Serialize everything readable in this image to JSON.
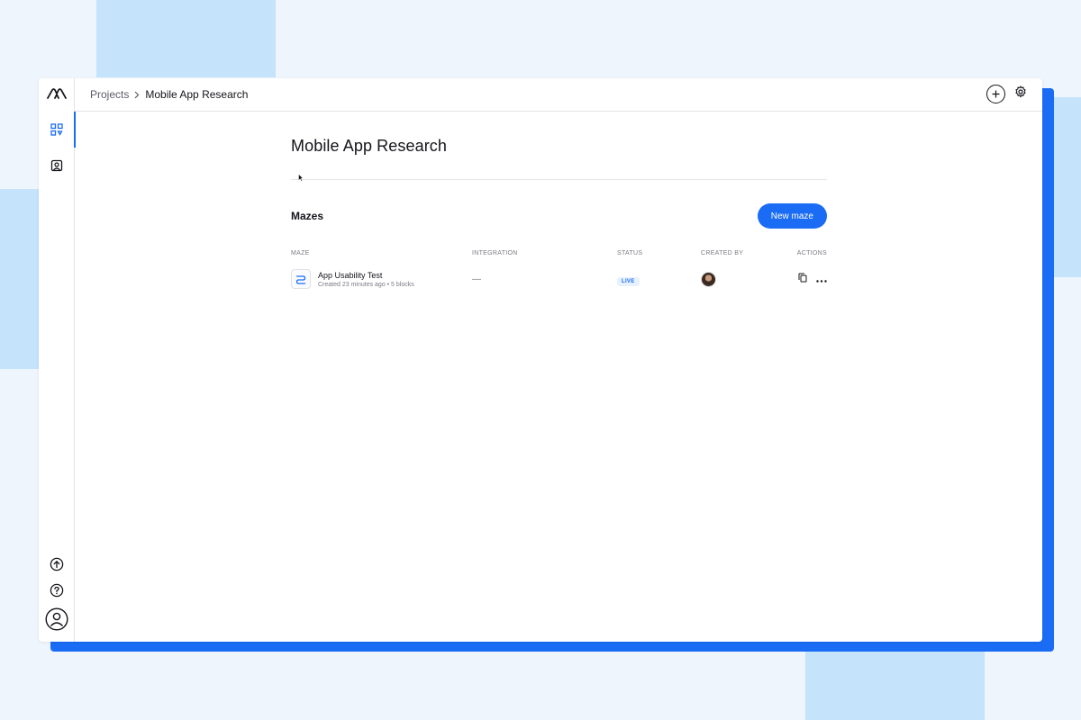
{
  "breadcrumb": {
    "parent": "Projects",
    "current": "Mobile App Research"
  },
  "page": {
    "title": "Mobile App Research"
  },
  "mazes": {
    "section_title": "Mazes",
    "new_button_label": "New maze",
    "columns": {
      "maze": "MAZE",
      "integration": "INTEGRATION",
      "status": "STATUS",
      "created_by": "CREATED BY",
      "actions": "ACTIONS"
    },
    "rows": [
      {
        "name": "App Usability Test",
        "meta": "Created 23 minutes ago • 5 blocks",
        "integration": "—",
        "status": "LIVE"
      }
    ]
  },
  "icons": {
    "logo": "maze-logo",
    "projects": "projects-icon",
    "people": "people-icon",
    "upgrade": "upgrade-icon",
    "help": "help-icon",
    "account": "account-icon",
    "add": "plus-icon",
    "settings": "gear-icon",
    "duplicate": "copy-icon",
    "more": "more-icon"
  },
  "colors": {
    "accent": "#1a6cf4",
    "background": "#eef5fd",
    "block": "#c5e3fb"
  }
}
